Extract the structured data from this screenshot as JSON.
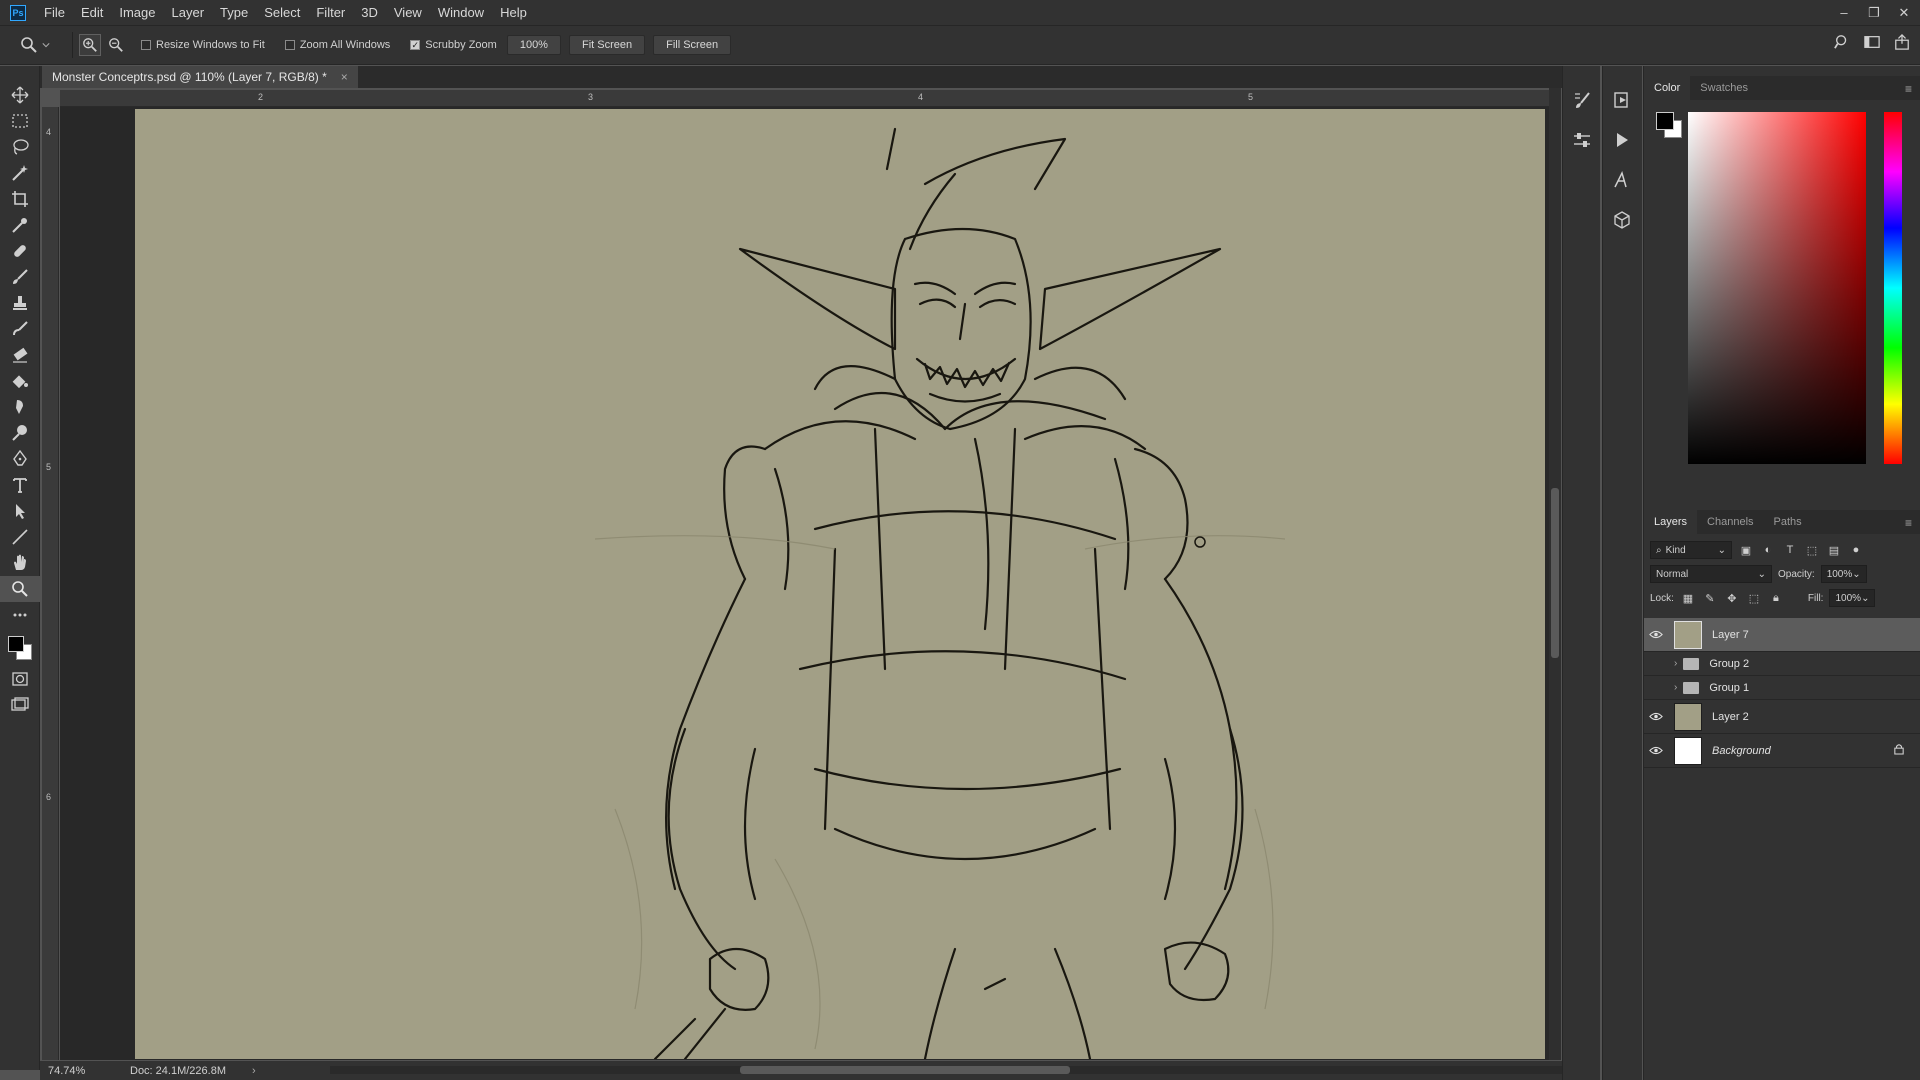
{
  "menu": {
    "app_icon": "Ps",
    "items": [
      "File",
      "Edit",
      "Image",
      "Layer",
      "Type",
      "Select",
      "Filter",
      "3D",
      "View",
      "Window",
      "Help"
    ],
    "window_controls": {
      "minimize": "–",
      "restore": "❐",
      "close": "✕"
    }
  },
  "options": {
    "resize_windows_label": "Resize Windows to Fit",
    "resize_windows_checked": false,
    "zoom_all_label": "Zoom All Windows",
    "zoom_all_checked": false,
    "scrubby_label": "Scrubby Zoom",
    "scrubby_checked": true,
    "check_glyph": "✓",
    "zoom_value": "100%",
    "fit_screen": "Fit Screen",
    "fill_screen": "Fill Screen"
  },
  "document": {
    "tab_title": "Monster Conceptrs.psd @ 110% (Layer 7, RGB/8) *",
    "close_glyph": "×",
    "ruler_top": [
      "2",
      "3",
      "4",
      "5"
    ],
    "ruler_left": [
      "4",
      "5",
      "6"
    ]
  },
  "status": {
    "zoom": "74.74%",
    "doc": "Doc: 24.1M/226.8M",
    "arrow": "›"
  },
  "color_panel": {
    "tabs": [
      "Color",
      "Swatches"
    ],
    "foreground": "#000000",
    "background": "#ffffff"
  },
  "layers_panel": {
    "tabs": [
      "Layers",
      "Channels",
      "Paths"
    ],
    "filter_kind": "Kind",
    "blend_mode": "Normal",
    "opacity_label": "Opacity:",
    "opacity_value": "100%",
    "lock_label": "Lock:",
    "fill_label": "Fill:",
    "fill_value": "100%",
    "layers": [
      {
        "name": "Layer 7",
        "visible": true,
        "selected": true
      },
      {
        "name": "Group 2",
        "visible": false
      },
      {
        "name": "Group 1",
        "visible": false
      },
      {
        "name": "Layer 2",
        "visible": true
      },
      {
        "name": "Background",
        "visible": true,
        "locked": true
      }
    ]
  },
  "colors": {
    "canvas": "#a29f86",
    "ui_dark": "#323232",
    "selected_layer": "#5c5c5c"
  }
}
